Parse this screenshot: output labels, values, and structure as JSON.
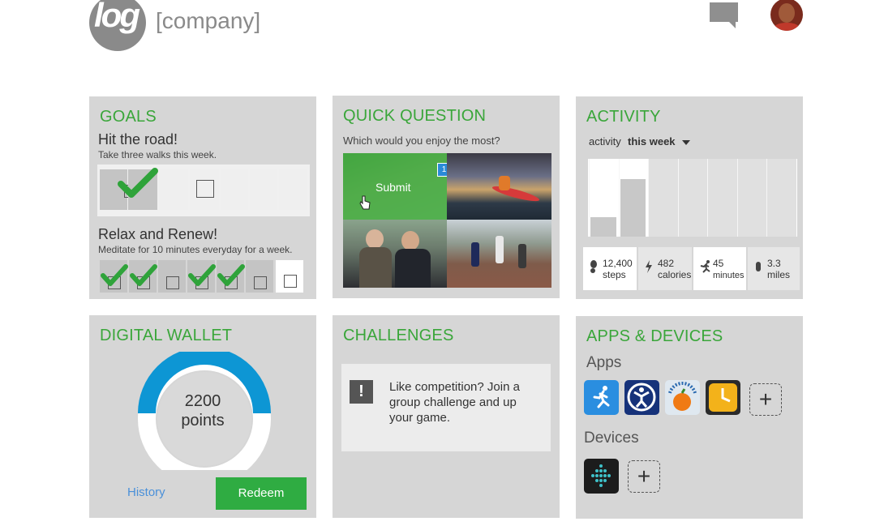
{
  "header": {
    "logo_text": "log",
    "company": "[company]",
    "icons": [
      "chat-icon",
      "user-avatar"
    ]
  },
  "goals": {
    "title": "GOALS",
    "goal1": {
      "title": "Hit the road!",
      "subtitle": "Take three walks this week.",
      "completed": 2,
      "total": 7
    },
    "goal2": {
      "title": "Relax and Renew!",
      "subtitle": "Meditate for 10 minutes everyday for a week.",
      "completed": 4,
      "total": 7
    }
  },
  "quick_question": {
    "title": "QUICK QUESTION",
    "prompt": "Which would you enjoy the most?",
    "submit_label": "Submit",
    "selected_badge": "1"
  },
  "activity": {
    "title": "ACTIVITY",
    "filter_label": "activity",
    "period": "this week",
    "bar_levels": [
      0.25,
      0.75,
      0,
      0,
      0,
      0,
      0
    ],
    "stats": [
      {
        "value": "12,400",
        "unit": "steps",
        "icon": "footprint-icon"
      },
      {
        "value": "482",
        "unit": "calories",
        "icon": "bolt-icon"
      },
      {
        "value": "45",
        "unit": "minutes",
        "icon": "runner-icon"
      },
      {
        "value": "3.3",
        "unit": "miles",
        "icon": "shoe-icon"
      }
    ]
  },
  "wallet": {
    "title": "DIGITAL WALLET",
    "points_value": "2200",
    "points_label": "points",
    "history_label": "History",
    "redeem_label": "Redeem",
    "accent": "#0d96d4"
  },
  "challenges": {
    "title": "CHALLENGES",
    "message": "Like competition? Join a group challenge and up your game."
  },
  "apps_devices": {
    "title": "APPS & DEVICES",
    "apps_label": "Apps",
    "devices_label": "Devices",
    "add_symbol": "+",
    "apps": [
      "runkeeper-icon",
      "fitness-app-icon",
      "nutrition-app-icon",
      "clock-app-icon"
    ],
    "devices": [
      "fitbit-icon"
    ]
  },
  "colors": {
    "green": "#3aa63a",
    "card": "#d6d6d6",
    "redeem": "#2fac42",
    "link": "#4a90d9"
  }
}
